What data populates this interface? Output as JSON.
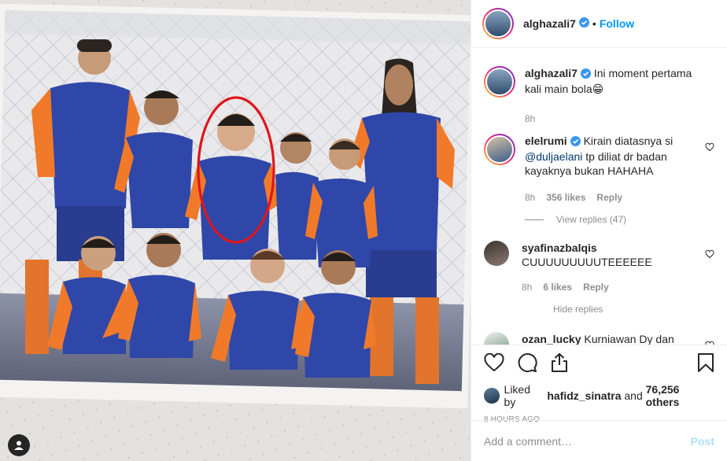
{
  "post": {
    "author": "alghazali7",
    "follow_label": "Follow",
    "dot": "•",
    "caption_user": "alghazali7",
    "caption_text": "Ini moment pertama kali main bola😁",
    "caption_age": "8h"
  },
  "comments": [
    {
      "user": "elelrumi",
      "verified": true,
      "text_before": "Kirain diatasnya si",
      "mention": "@duljaelani",
      "text_after": "tp diliat dr badan kayaknya bukan HAHAHA",
      "age": "8h",
      "likes": "356 likes",
      "reply_label": "Reply",
      "replies_label": "View replies (47)"
    },
    {
      "user": "syafinazbalqis",
      "verified": false,
      "text": "CUUUUUUUUUTEEEEEE",
      "age": "8h",
      "likes": "6 likes",
      "reply_label": "Reply",
      "replies_label": "Hide replies"
    },
    {
      "user": "ozan_lucky",
      "verified": false,
      "text": "Kurniawan Dy dan"
    }
  ],
  "likes": {
    "prefix": "Liked by",
    "user": "hafidz_sinatra",
    "middle": "and",
    "count": "76,256 others"
  },
  "timestamp": "8 HOURS AGO",
  "add_comment": {
    "placeholder": "Add a comment…",
    "post_label": "Post"
  },
  "colors": {
    "accent": "#0095f6",
    "post_disabled": "#b2dffc",
    "muted": "#8e8e8e",
    "jersey_blue": "#2f47a8",
    "jersey_orange": "#f07a2a",
    "circle": "#e0151b"
  },
  "icons": [
    "verified-badge-icon",
    "heart-icon",
    "comment-icon",
    "share-icon",
    "bookmark-icon",
    "user-tag-icon"
  ]
}
